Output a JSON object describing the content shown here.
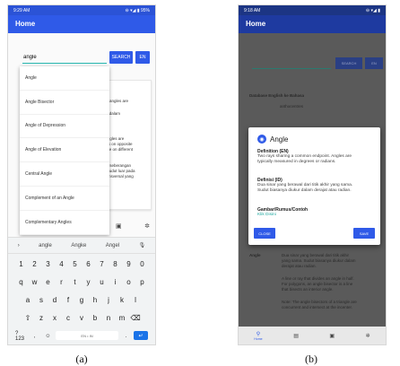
{
  "screen_a": {
    "status_time": "9:29 AM",
    "status_right": "⊖ ▾◢ ▮ 95%",
    "app_title": "Home",
    "search_value": "angle",
    "search_label": "SEARCH",
    "lang_label": "EN",
    "suggestions": [
      "Angle",
      "Angle Bisector",
      "Angle of Depression",
      "Angle of Elevation",
      "Central Angle",
      "Complement of an Angle",
      "Complementary Angles"
    ],
    "card_lines": [
      "e",
      "interior angles are",
      "udut di dalam",
      "lancip.",
      "erior angles are",
      "r angles on opposite",
      "which lie on different",
      "ejar berseberangan",
      "sudut-sudut luar pada",
      "dari transversal yang"
    ],
    "keyboard": {
      "suggest": [
        "angle",
        "Angke",
        "Angel"
      ],
      "row_numbers": [
        "1",
        "2",
        "3",
        "4",
        "5",
        "6",
        "7",
        "8",
        "9",
        "0"
      ],
      "row1": [
        "q",
        "w",
        "e",
        "r",
        "t",
        "y",
        "u",
        "i",
        "o",
        "p"
      ],
      "row2": [
        "a",
        "s",
        "d",
        "f",
        "g",
        "h",
        "j",
        "k",
        "l"
      ],
      "row3": [
        "z",
        "x",
        "c",
        "v",
        "b",
        "n",
        "m"
      ],
      "mode_key": "?123",
      "comma": ",",
      "space_label": "EN • IN",
      "period": "."
    },
    "caption": "(a)"
  },
  "screen_b": {
    "status_time": "9:18 AM",
    "status_right": "⊖ ▾◢ ▮",
    "app_title": "Home",
    "search_label": "SEARCH",
    "lang_label": "EN",
    "table_header": "Database   English   ke   Bahasa",
    "table_word": "anthocentres",
    "dialog_title": "Angle",
    "def_en_label": "Definition (EN)",
    "def_en_text_1": "Two rays sharing a common endpoint. Angles are",
    "def_en_text_2": "typically measured in degrees or radians.",
    "def_id_label": "Definisi (ID)",
    "def_id_text_1": "Dua sinar yang berawal dari titik akhir yang sama.",
    "def_id_text_2": "Sudut biasanya diukur dalam derajat atau radian.",
    "formula_label": "Gambar/Rumus/Contoh",
    "formula_link": "Klik Disini",
    "close_label": "CLOSE",
    "save_label": "SAVE",
    "bg_lines": [
      "Angle",
      "Dua sinar yang berawal dari titik akhir",
      "yang sama. Sudut biasanya diukur dalam",
      "derajat atau radian.",
      "A line or ray that divides an angle in half.",
      "For polygons, an angle bisector is a line",
      "that bisects an interior angle.",
      "Note: The angle bisectors of a triangle are",
      "concurrent and intersect at the incenter."
    ],
    "nav_home_label": "Home",
    "caption": "(b)"
  }
}
